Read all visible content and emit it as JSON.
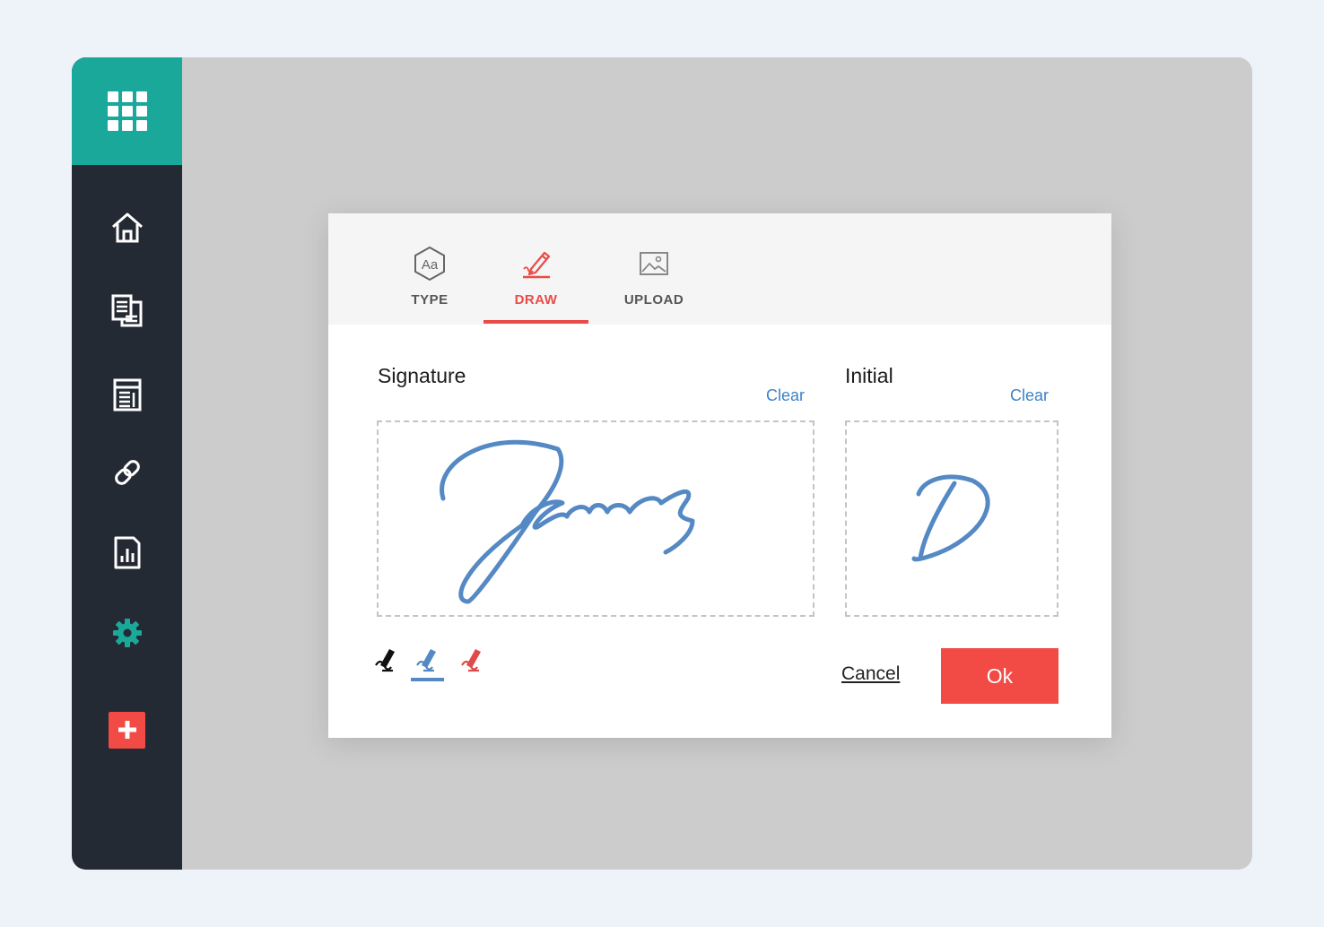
{
  "sidebar": {
    "brand_color": "#1aa89a",
    "background": "#242a33",
    "items": [
      {
        "icon": "home-icon",
        "active": false
      },
      {
        "icon": "documents-icon",
        "active": false
      },
      {
        "icon": "templates-icon",
        "active": false
      },
      {
        "icon": "link-icon",
        "active": false
      },
      {
        "icon": "reports-icon",
        "active": false
      },
      {
        "icon": "gear-icon",
        "active": true
      },
      {
        "icon": "add-icon",
        "active": false
      }
    ]
  },
  "dialog": {
    "tabs": [
      {
        "label": "TYPE",
        "icon": "type-icon",
        "active": false
      },
      {
        "label": "DRAW",
        "icon": "draw-icon",
        "active": true
      },
      {
        "label": "UPLOAD",
        "icon": "image-icon",
        "active": false
      }
    ],
    "signature": {
      "title": "Signature",
      "clear_label": "Clear",
      "drawn_text": "James"
    },
    "initial": {
      "title": "Initial",
      "clear_label": "Clear",
      "drawn_text": "D"
    },
    "ink_colors": [
      {
        "name": "black",
        "color": "#111111",
        "selected": false
      },
      {
        "name": "blue",
        "color": "#5589c4",
        "selected": true
      },
      {
        "name": "red",
        "color": "#e04a4a",
        "selected": false
      }
    ],
    "cancel_label": "Cancel",
    "ok_label": "Ok",
    "accent_color": "#e84c48",
    "link_color": "#3c82c8"
  }
}
